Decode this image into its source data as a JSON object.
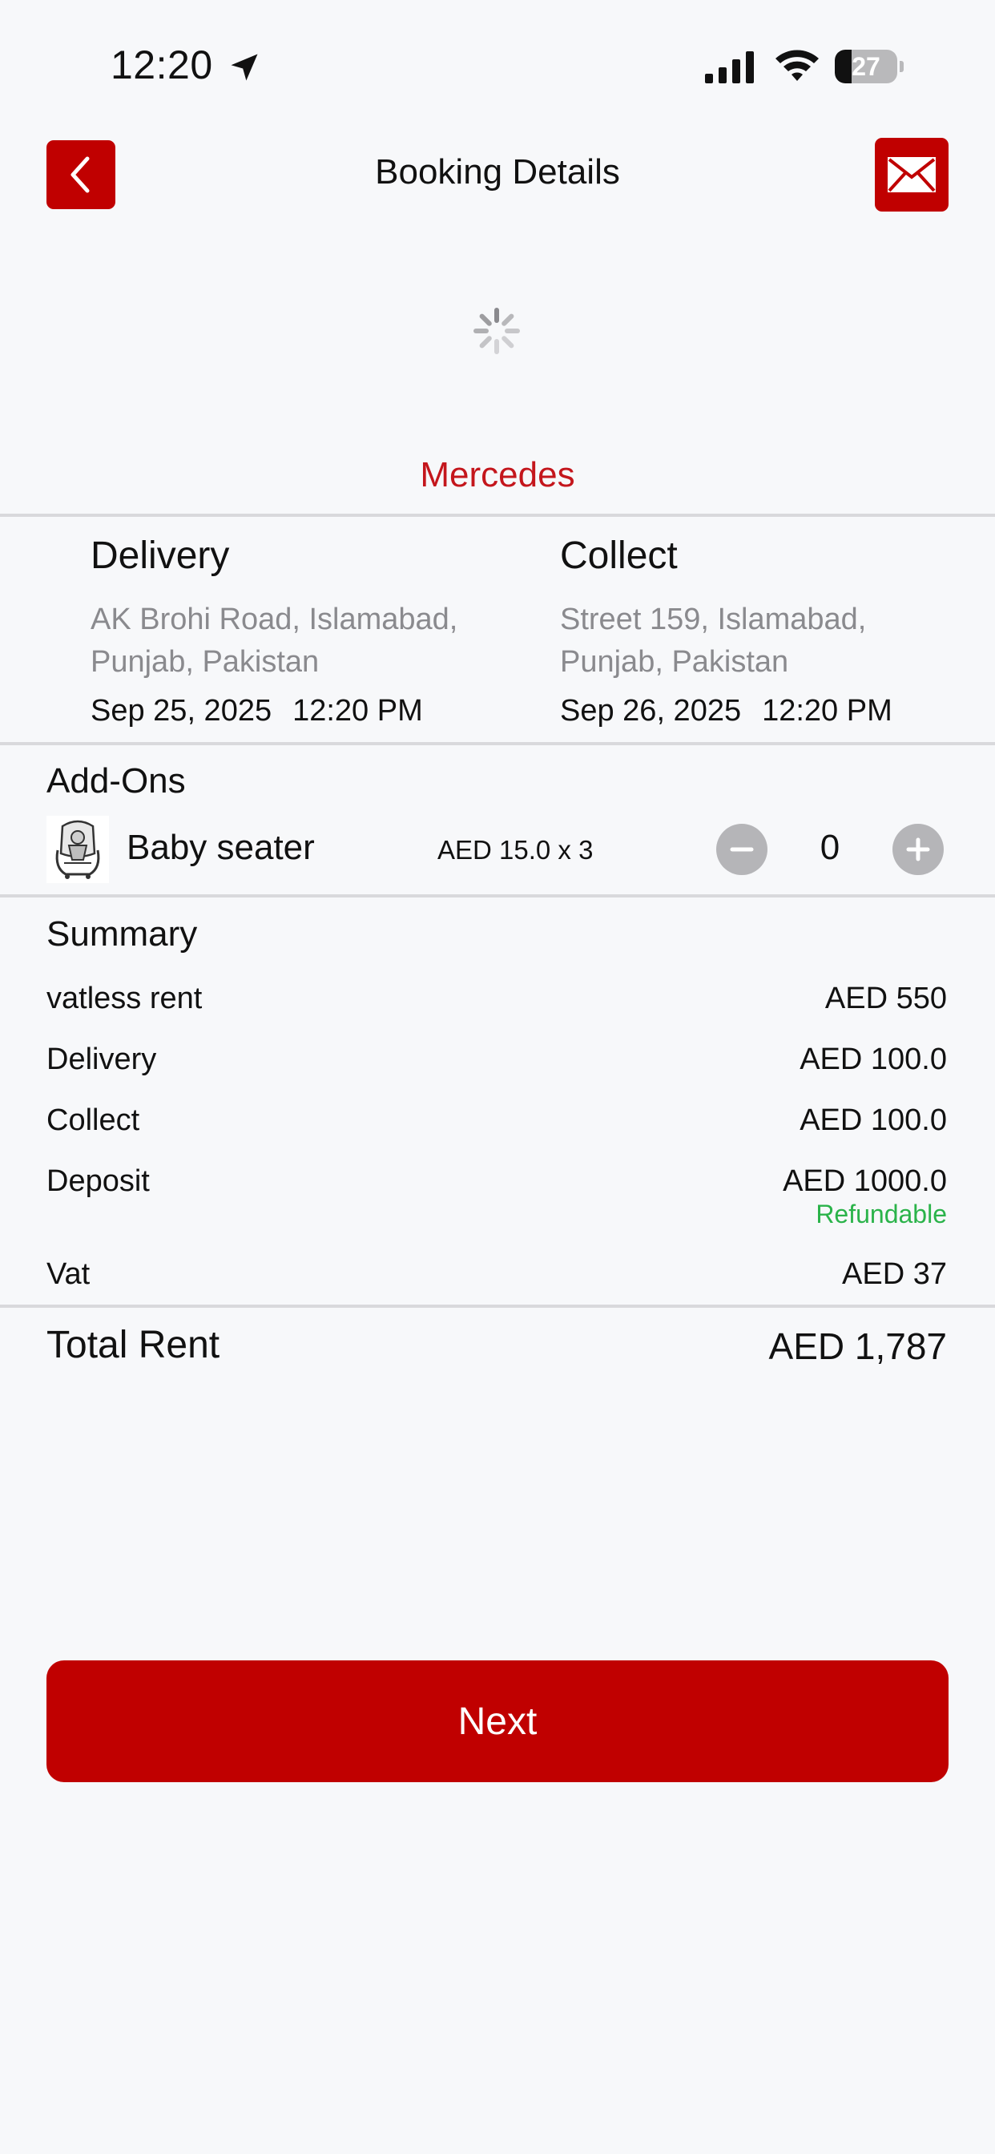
{
  "status_bar": {
    "time": "12:20",
    "battery": "27",
    "battery_level_percent": 27
  },
  "header": {
    "title": "Booking Details"
  },
  "car": {
    "name": "Mercedes"
  },
  "delivery": {
    "title": "Delivery",
    "address": "AK Brohi Road, Islamabad, Punjab, Pakistan",
    "date": "Sep 25, 2025",
    "time": "12:20 PM"
  },
  "collect": {
    "title": "Collect",
    "address": "Street 159, Islamabad, Punjab, Pakistan",
    "date": "Sep 26, 2025",
    "time": "12:20 PM"
  },
  "addons": {
    "title": "Add-Ons",
    "items": [
      {
        "name": "Baby seater",
        "price": "AED 15.0 x 3",
        "quantity": "0"
      }
    ]
  },
  "summary": {
    "title": "Summary",
    "rows": [
      {
        "label": "vatless rent",
        "value": "AED 550"
      },
      {
        "label": "Delivery",
        "value": "AED 100.0"
      },
      {
        "label": "Collect",
        "value": "AED 100.0"
      },
      {
        "label": "Deposit",
        "value": "AED 1000.0",
        "note": "Refundable"
      },
      {
        "label": "Vat",
        "value": "AED 37"
      }
    ]
  },
  "total": {
    "label": "Total Rent",
    "value": "AED 1,787"
  },
  "actions": {
    "next_label": "Next"
  },
  "colors": {
    "accent": "#c00000",
    "brand_text": "#c4161c",
    "refundable": "#2bb34a"
  }
}
